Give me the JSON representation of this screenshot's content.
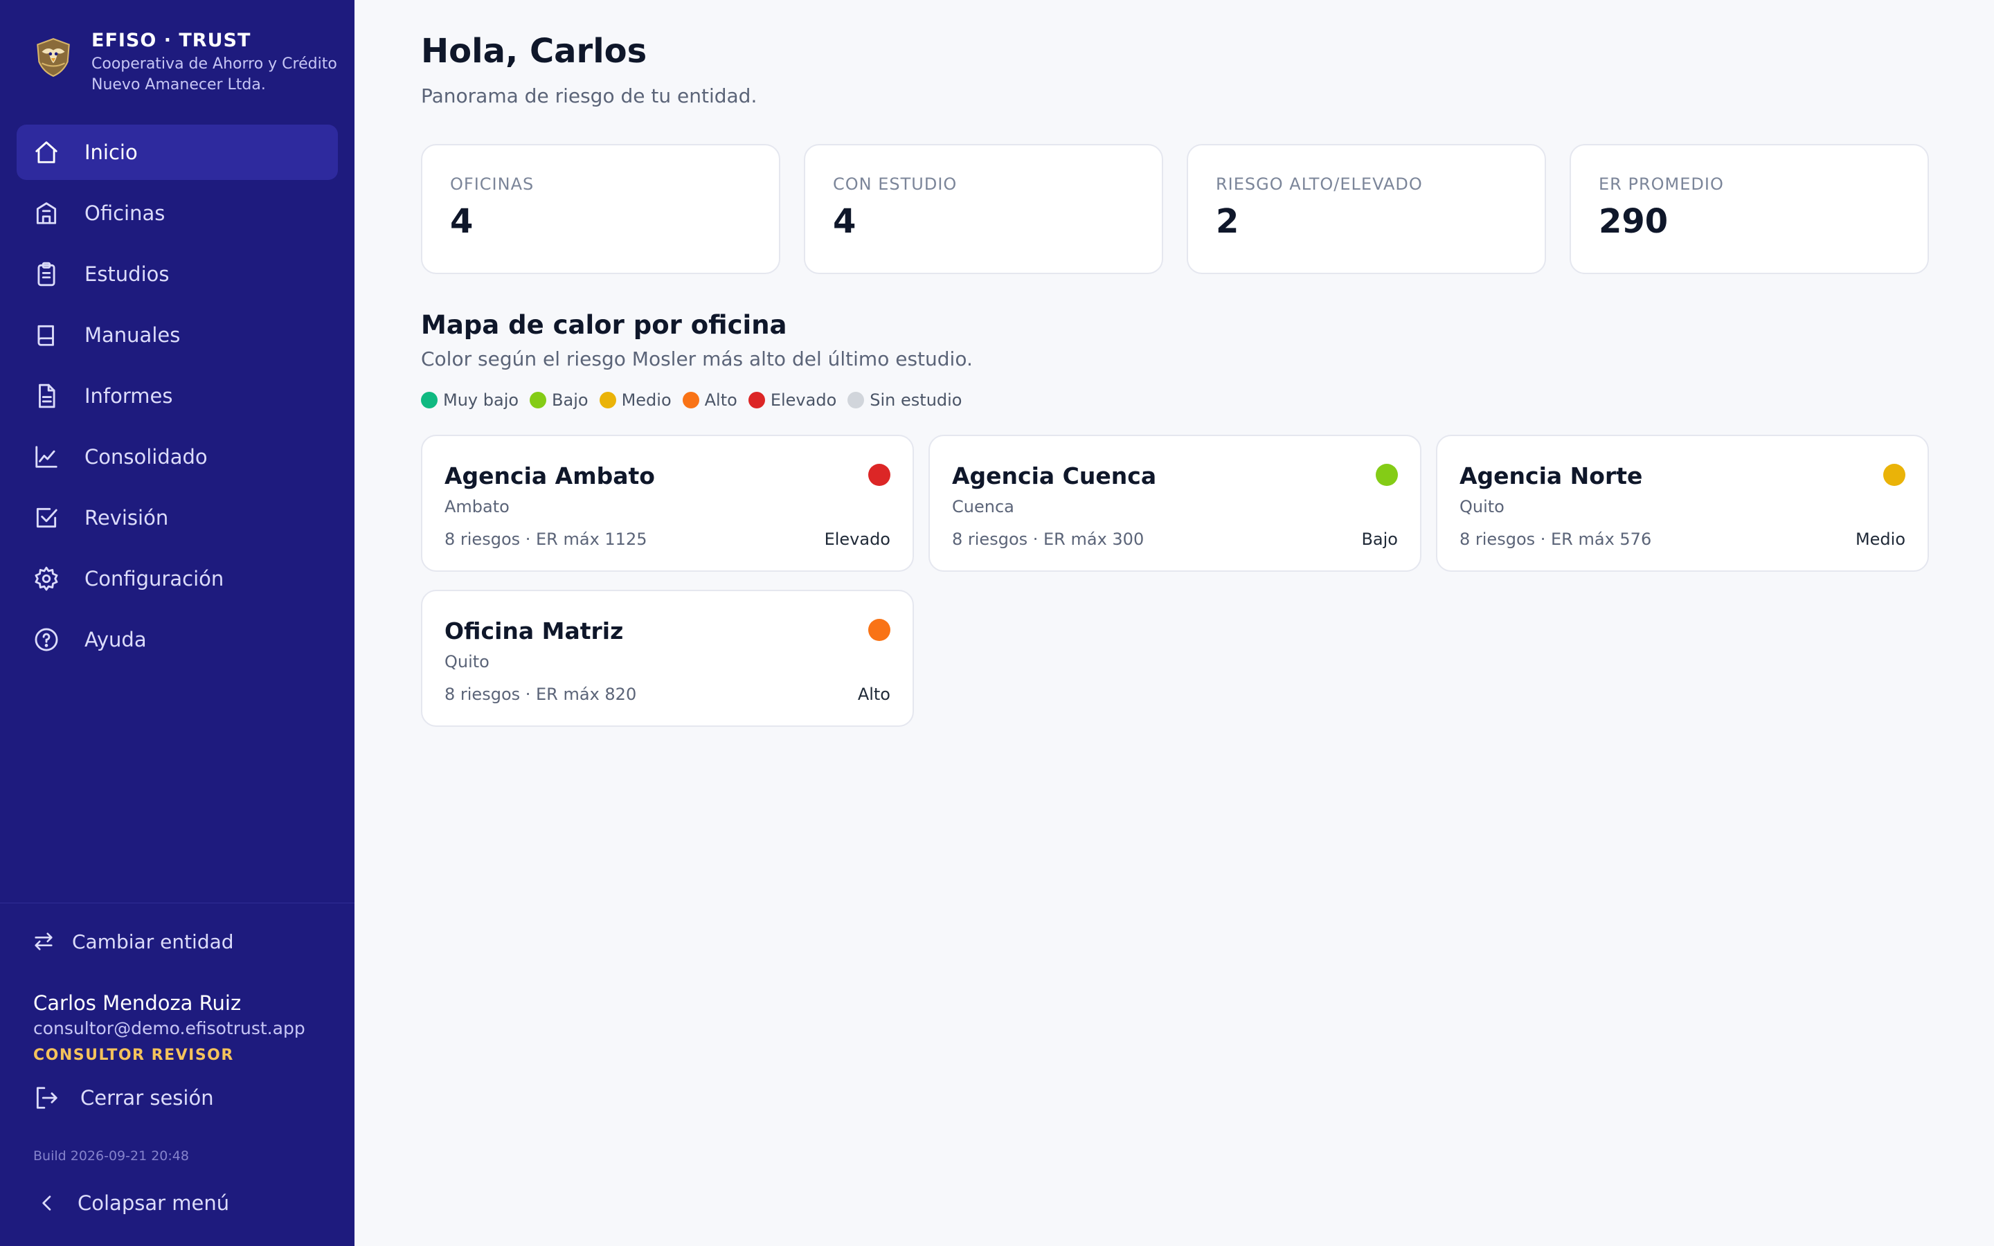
{
  "brand": {
    "name": "EFISO · TRUST",
    "entity": "Cooperativa de Ahorro y Crédito Nuevo Amanecer Ltda."
  },
  "nav": [
    {
      "label": "Inicio",
      "icon": "home-icon",
      "active": true
    },
    {
      "label": "Oficinas",
      "icon": "building-icon",
      "active": false
    },
    {
      "label": "Estudios",
      "icon": "clipboard-icon",
      "active": false
    },
    {
      "label": "Manuales",
      "icon": "book-icon",
      "active": false
    },
    {
      "label": "Informes",
      "icon": "document-icon",
      "active": false
    },
    {
      "label": "Consolidado",
      "icon": "chart-line-icon",
      "active": false
    },
    {
      "label": "Revisión",
      "icon": "checkbox-icon",
      "active": false
    },
    {
      "label": "Configuración",
      "icon": "gear-icon",
      "active": false
    },
    {
      "label": "Ayuda",
      "icon": "help-icon",
      "active": false
    }
  ],
  "sidebar_bottom": {
    "switch_label": "Cambiar entidad",
    "user_name": "Carlos Mendoza Ruiz",
    "user_email": "consultor@demo.efisotrust.app",
    "user_role": "CONSULTOR REVISOR",
    "logout_label": "Cerrar sesión",
    "build": "Build 2026-09-21 20:48",
    "collapse_label": "Colapsar menú"
  },
  "header": {
    "greeting": "Hola, Carlos",
    "subtitle": "Panorama de riesgo de tu entidad."
  },
  "stats": [
    {
      "label": "OFICINAS",
      "value": "4"
    },
    {
      "label": "CON ESTUDIO",
      "value": "4"
    },
    {
      "label": "RIESGO ALTO/ELEVADO",
      "value": "2"
    },
    {
      "label": "ER PROMEDIO",
      "value": "290"
    }
  ],
  "heatmap": {
    "title": "Mapa de calor por oficina",
    "subtitle": "Color según el riesgo Mosler más alto del último estudio.",
    "legend": [
      {
        "label": "Muy bajo",
        "color": "#10b981"
      },
      {
        "label": "Bajo",
        "color": "#84cc16"
      },
      {
        "label": "Medio",
        "color": "#eab308"
      },
      {
        "label": "Alto",
        "color": "#f97316"
      },
      {
        "label": "Elevado",
        "color": "#dc2626"
      },
      {
        "label": "Sin estudio",
        "color": "#d1d5db"
      }
    ],
    "offices": [
      {
        "name": "Agencia Ambato",
        "city": "Ambato",
        "meta": "8 riesgos · ER máx 1125",
        "level": "Elevado",
        "color": "#dc2626"
      },
      {
        "name": "Agencia Cuenca",
        "city": "Cuenca",
        "meta": "8 riesgos · ER máx 300",
        "level": "Bajo",
        "color": "#84cc16"
      },
      {
        "name": "Agencia Norte",
        "city": "Quito",
        "meta": "8 riesgos · ER máx 576",
        "level": "Medio",
        "color": "#eab308"
      },
      {
        "name": "Oficina Matriz",
        "city": "Quito",
        "meta": "8 riesgos · ER máx 820",
        "level": "Alto",
        "color": "#f97316"
      }
    ]
  }
}
